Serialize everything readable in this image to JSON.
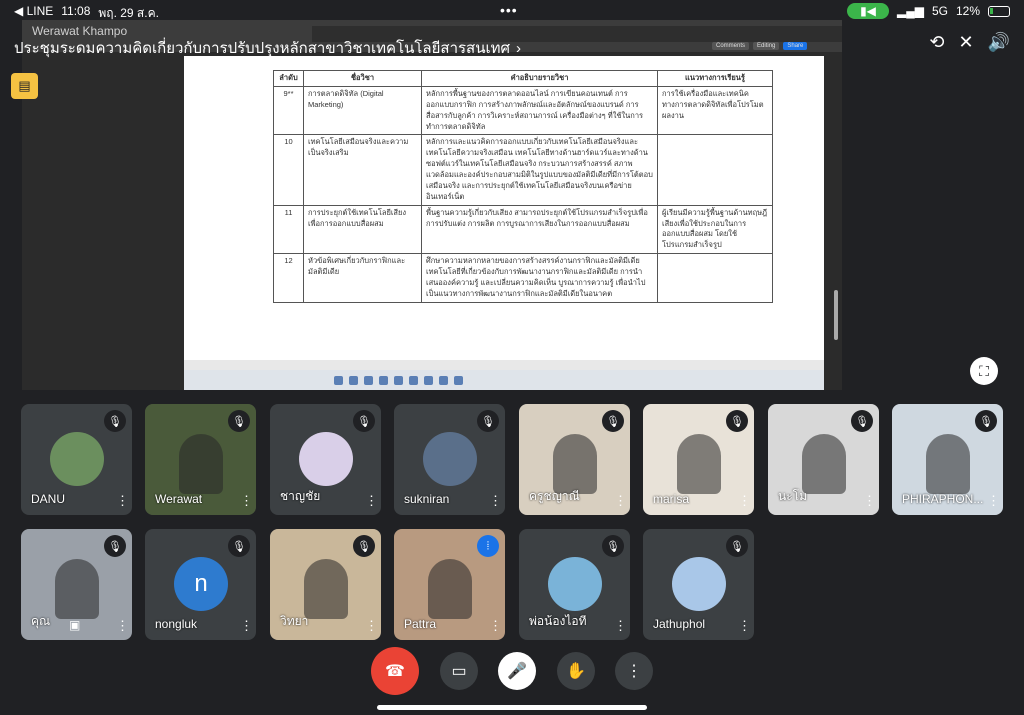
{
  "status_bar": {
    "back_app": "◀ LINE",
    "time": "11:08",
    "date": "พฤ. 29 ส.ค.",
    "network": "5G",
    "battery": "12%"
  },
  "meeting": {
    "title": "ประชุมระดมความคิดเกี่ยวกับการปรับปรุงหลักสาขาวิชาเทคโนโลยีสารสนเทศ",
    "presenter_label": "Werawat Khampo"
  },
  "document": {
    "toolbar": [
      "Comments",
      "Editing",
      "Share"
    ],
    "headers": [
      "ลำดับ",
      "ชื่อวิชา",
      "คำอธิบายรายวิชา",
      "แนวทางการเรียนรู้"
    ],
    "rows": [
      {
        "num": "9**",
        "name": "การตลาดดิจิทัล (Digital Marketing)",
        "desc": "หลักการพื้นฐานของการตลาดออนไลน์ การเขียนคอนเทนต์ การออกแบบกราฟิก การสร้างภาพลักษณ์และอัตลักษณ์ของแบรนด์ การสื่อสารกับลูกค้า การวิเคราะห์สถานการณ์ เครื่องมือต่างๆ ที่ใช้ในการทำการตลาดดิจิทัล",
        "guide": "การใช้เครื่องมือและเทคนิคทางการตลาดดิจิทัลเพื่อโปรโมตผลงาน"
      },
      {
        "num": "10",
        "name": "เทคโนโลยีเสมือนจริงและความเป็นจริงเสริม",
        "desc": "หลักการและแนวคิดการออกแบบเกี่ยวกับเทคโนโลยีเสมือนจริงและเทคโนโลยีความจริงเสมือน เทคโนโลยีทางด้านฮาร์ดแวร์และทางด้านซอฟต์แวร์ในเทคโนโลยีเสมือนจริง กระบวนการสร้างสรรค์ สภาพแวดล้อมและองค์ประกอบสามมิติในรูปแบบของมัลติมีเดียที่มีการโต้ตอบเสมือนจริง และการประยุกต์ใช้เทคโนโลยีเสมือนจริงบนเครือข่ายอินเทอร์เน็ต",
        "guide": ""
      },
      {
        "num": "11",
        "name": "การประยุกต์ใช้เทคโนโลยีเสียงเพื่อการออกแบบสื่อผสม",
        "desc": "พื้นฐานความรู้เกี่ยวกับเสียง สามารถประยุกต์ใช้โปรแกรมสำเร็จรูปเพื่อการปรับแต่ง การผลิต การบูรณาการเสียงในการออกแบบสื่อผสม",
        "guide": "ผู้เรียนมีความรู้พื้นฐานด้านทฤษฎีเสียงเพื่อใช้ประกอบในการออกแบบสื่อผสม โดยใช้โปรแกรมสำเร็จรูป"
      },
      {
        "num": "12",
        "name": "หัวข้อพิเศษเกี่ยวกับกราฟิกและมัลติมีเดีย",
        "desc": "ศึกษาความหลากหลายของการสร้างสรรค์งานกราฟิกและมัลติมีเดีย เทคโนโลยีที่เกี่ยวข้องกับการพัฒนางานกราฟิกและมัลติมีเดีย การนำเสนอองค์ความรู้ และเปลี่ยนความคิดเห็น บูรณาการความรู้ เพื่อนำไปเป็นแนวทางการพัฒนางานกราฟิกและมัลติมีเดียในอนาคต",
        "guide": ""
      }
    ]
  },
  "participants": [
    {
      "name": "DANU",
      "type": "avatar",
      "color": "#6b8f5e"
    },
    {
      "name": "Werawat",
      "type": "video",
      "color": "#4a5a3a"
    },
    {
      "name": "ชาญชัย",
      "type": "avatar",
      "color": "#d9cfe8"
    },
    {
      "name": "sukniran",
      "type": "avatar",
      "color": "#5a6f8a"
    },
    {
      "name": "ครูชญาณี",
      "type": "video",
      "color": "#d8cfc0"
    },
    {
      "name": "marisa",
      "type": "video",
      "color": "#e8e2d8"
    },
    {
      "name": "นะโม",
      "type": "video",
      "color": "#d8d8d8"
    },
    {
      "name": "PHIRAPHON...",
      "type": "video",
      "color": "#cfd8e0"
    },
    {
      "name": "คุณ",
      "type": "video",
      "color": "#9aa0a8"
    },
    {
      "name": "nongluk",
      "type": "letter",
      "letter": "n",
      "color": "#2e7bcf"
    },
    {
      "name": "วิทยา",
      "type": "video",
      "color": "#c9b79a"
    },
    {
      "name": "Pattra",
      "type": "video",
      "color": "#b89a80"
    },
    {
      "name": "พ่อน้องไอที",
      "type": "avatar",
      "color": "#7ab3d8"
    },
    {
      "name": "Jathuphol",
      "type": "avatar",
      "color": "#a9c7e8"
    }
  ],
  "icons": {
    "mic_off": "mic-off-icon",
    "more": "more-vert-icon",
    "end_call": "end-call-icon",
    "camera": "camera-icon",
    "hand": "raise-hand-icon",
    "fullscreen": "fullscreen-icon"
  },
  "colors": {
    "background": "#202124",
    "tile": "#3c4043",
    "end_call": "#ea4335",
    "camera_pill": "#3bb54a",
    "caption_button": "#f5c242",
    "speaking": "#1a73e8"
  }
}
